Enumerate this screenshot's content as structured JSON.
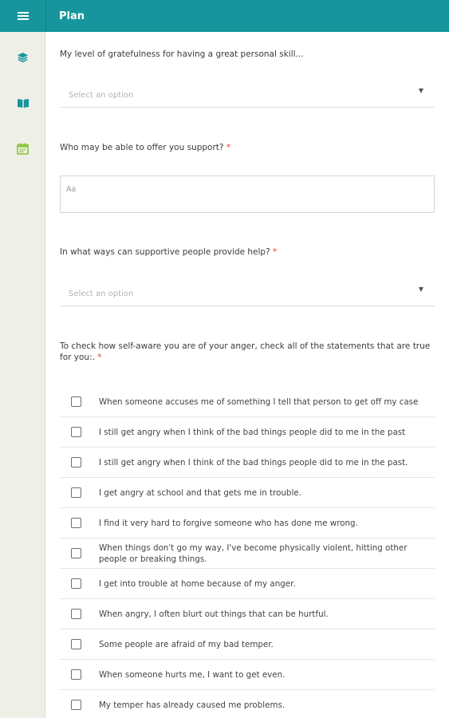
{
  "header": {
    "title": "Plan"
  },
  "sidebar": {
    "menu_icon": "hamburger-menu-icon",
    "items": [
      {
        "icon": "layers-icon",
        "color": "#17959d"
      },
      {
        "icon": "book-icon",
        "color": "#17959d"
      },
      {
        "icon": "calendar-icon",
        "color": "#8dc63f"
      }
    ]
  },
  "form": {
    "q1": {
      "label": "My level of gratefulness for having a great personal skill...",
      "placeholder": "Select an option"
    },
    "q2": {
      "label": "Who may be able to offer you support?",
      "required_mark": "*",
      "placeholder": "Aa"
    },
    "q3": {
      "label": "In what ways can supportive people provide help?",
      "required_mark": "*",
      "placeholder": "Select an option"
    },
    "q4": {
      "label": "To check how self-aware you are of your anger, check all of the statements that are true for you:.",
      "required_mark": "*",
      "options": [
        "When someone accuses me of something I tell that person to get off my case",
        "I still get angry when I think of the bad things people did to me in the past",
        "I still get angry when I think of the bad things people did to me in the past.",
        "I get angry at school and that gets me in trouble.",
        "I find it very hard to forgive someone who has done me wrong.",
        "When things don't go my way, I've become physically violent, hitting other people or breaking things.",
        "I get into trouble at home because of my anger.",
        "When angry, I often blurt out things that can be hurtful.",
        "Some people are afraid of my bad temper.",
        "When someone hurts me, I want to get even.",
        "My temper has already caused me problems."
      ]
    }
  },
  "colors": {
    "accent": "#17959d",
    "required": "#e53935",
    "sidebar_bg": "#eef0e7"
  }
}
